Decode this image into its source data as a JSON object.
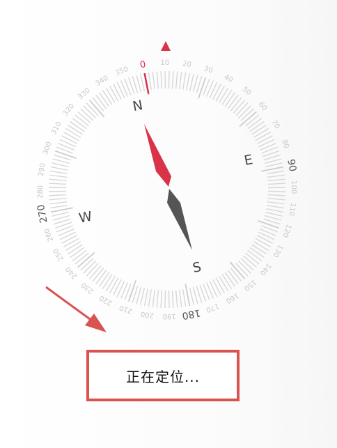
{
  "status": {
    "text": "正在定位..."
  },
  "compass": {
    "heading_marker_color": "#d9334a",
    "needle_north_color": "#d9334a",
    "needle_south_color": "#555555",
    "cardinals": {
      "n": "N",
      "e": "E",
      "s": "S",
      "w": "W"
    },
    "degree_labels": [
      {
        "deg": 0,
        "text": "0"
      },
      {
        "deg": 10,
        "text": "10"
      },
      {
        "deg": 20,
        "text": "20"
      },
      {
        "deg": 30,
        "text": "30"
      },
      {
        "deg": 40,
        "text": "40"
      },
      {
        "deg": 50,
        "text": "50"
      },
      {
        "deg": 60,
        "text": "60"
      },
      {
        "deg": 70,
        "text": "70"
      },
      {
        "deg": 80,
        "text": "80"
      },
      {
        "deg": 90,
        "text": "90"
      },
      {
        "deg": 100,
        "text": "100"
      },
      {
        "deg": 110,
        "text": "110"
      },
      {
        "deg": 120,
        "text": "120"
      },
      {
        "deg": 130,
        "text": "130"
      },
      {
        "deg": 140,
        "text": "140"
      },
      {
        "deg": 150,
        "text": "150"
      },
      {
        "deg": 160,
        "text": "160"
      },
      {
        "deg": 170,
        "text": "170"
      },
      {
        "deg": 180,
        "text": "180"
      },
      {
        "deg": 190,
        "text": "190"
      },
      {
        "deg": 200,
        "text": "200"
      },
      {
        "deg": 210,
        "text": "210"
      },
      {
        "deg": 220,
        "text": "220"
      },
      {
        "deg": 230,
        "text": "230"
      },
      {
        "deg": 240,
        "text": "240"
      },
      {
        "deg": 250,
        "text": "250"
      },
      {
        "deg": 260,
        "text": "260"
      },
      {
        "deg": 270,
        "text": "270"
      },
      {
        "deg": 280,
        "text": "280"
      },
      {
        "deg": 290,
        "text": "290"
      },
      {
        "deg": 300,
        "text": "300"
      },
      {
        "deg": 310,
        "text": "310"
      },
      {
        "deg": 320,
        "text": "320"
      },
      {
        "deg": 330,
        "text": "330"
      },
      {
        "deg": 340,
        "text": "340"
      },
      {
        "deg": 350,
        "text": "350"
      }
    ]
  },
  "annotation": {
    "arrow_color": "#d9534f",
    "box_color": "#d9534f"
  }
}
